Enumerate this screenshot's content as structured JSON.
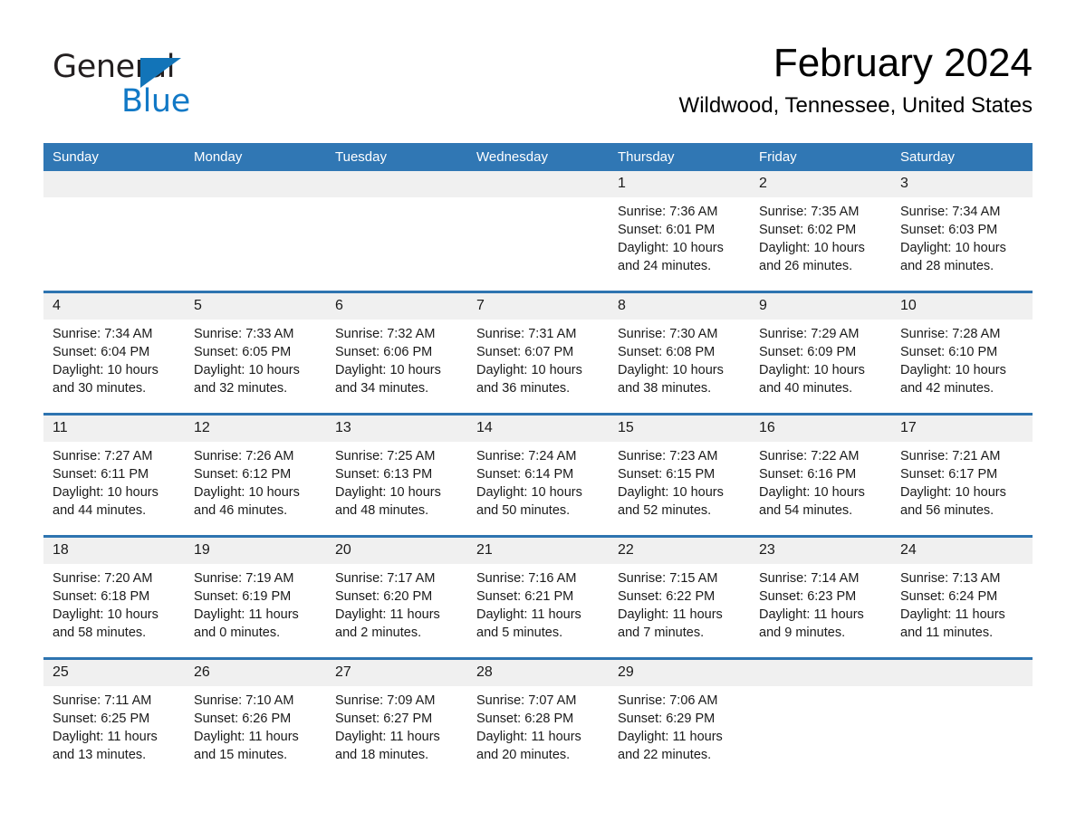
{
  "logo": {
    "word_one": "General",
    "word_two": "Blue",
    "triangle_color": "#1274b8",
    "blue_text_color": "#1279c6",
    "triangle_icon": "right-triangle-icon"
  },
  "header": {
    "month_title": "February 2024",
    "location": "Wildwood, Tennessee, United States"
  },
  "theme": {
    "header_blue": "#3077b4",
    "row_divider_blue": "#2e74b0",
    "daynum_band": "#f0f0f0",
    "page_background": "#ffffff"
  },
  "calendar": {
    "weekday_headers": [
      "Sunday",
      "Monday",
      "Tuesday",
      "Wednesday",
      "Thursday",
      "Friday",
      "Saturday"
    ],
    "weeks": [
      [
        {
          "day": "",
          "sunrise": "",
          "sunset": "",
          "daylight_line1": "",
          "daylight_line2": "",
          "empty": true
        },
        {
          "day": "",
          "sunrise": "",
          "sunset": "",
          "daylight_line1": "",
          "daylight_line2": "",
          "empty": true
        },
        {
          "day": "",
          "sunrise": "",
          "sunset": "",
          "daylight_line1": "",
          "daylight_line2": "",
          "empty": true
        },
        {
          "day": "",
          "sunrise": "",
          "sunset": "",
          "daylight_line1": "",
          "daylight_line2": "",
          "empty": true
        },
        {
          "day": "1",
          "sunrise": "Sunrise: 7:36 AM",
          "sunset": "Sunset: 6:01 PM",
          "daylight_line1": "Daylight: 10 hours",
          "daylight_line2": "and 24 minutes.",
          "empty": false
        },
        {
          "day": "2",
          "sunrise": "Sunrise: 7:35 AM",
          "sunset": "Sunset: 6:02 PM",
          "daylight_line1": "Daylight: 10 hours",
          "daylight_line2": "and 26 minutes.",
          "empty": false
        },
        {
          "day": "3",
          "sunrise": "Sunrise: 7:34 AM",
          "sunset": "Sunset: 6:03 PM",
          "daylight_line1": "Daylight: 10 hours",
          "daylight_line2": "and 28 minutes.",
          "empty": false
        }
      ],
      [
        {
          "day": "4",
          "sunrise": "Sunrise: 7:34 AM",
          "sunset": "Sunset: 6:04 PM",
          "daylight_line1": "Daylight: 10 hours",
          "daylight_line2": "and 30 minutes.",
          "empty": false
        },
        {
          "day": "5",
          "sunrise": "Sunrise: 7:33 AM",
          "sunset": "Sunset: 6:05 PM",
          "daylight_line1": "Daylight: 10 hours",
          "daylight_line2": "and 32 minutes.",
          "empty": false
        },
        {
          "day": "6",
          "sunrise": "Sunrise: 7:32 AM",
          "sunset": "Sunset: 6:06 PM",
          "daylight_line1": "Daylight: 10 hours",
          "daylight_line2": "and 34 minutes.",
          "empty": false
        },
        {
          "day": "7",
          "sunrise": "Sunrise: 7:31 AM",
          "sunset": "Sunset: 6:07 PM",
          "daylight_line1": "Daylight: 10 hours",
          "daylight_line2": "and 36 minutes.",
          "empty": false
        },
        {
          "day": "8",
          "sunrise": "Sunrise: 7:30 AM",
          "sunset": "Sunset: 6:08 PM",
          "daylight_line1": "Daylight: 10 hours",
          "daylight_line2": "and 38 minutes.",
          "empty": false
        },
        {
          "day": "9",
          "sunrise": "Sunrise: 7:29 AM",
          "sunset": "Sunset: 6:09 PM",
          "daylight_line1": "Daylight: 10 hours",
          "daylight_line2": "and 40 minutes.",
          "empty": false
        },
        {
          "day": "10",
          "sunrise": "Sunrise: 7:28 AM",
          "sunset": "Sunset: 6:10 PM",
          "daylight_line1": "Daylight: 10 hours",
          "daylight_line2": "and 42 minutes.",
          "empty": false
        }
      ],
      [
        {
          "day": "11",
          "sunrise": "Sunrise: 7:27 AM",
          "sunset": "Sunset: 6:11 PM",
          "daylight_line1": "Daylight: 10 hours",
          "daylight_line2": "and 44 minutes.",
          "empty": false
        },
        {
          "day": "12",
          "sunrise": "Sunrise: 7:26 AM",
          "sunset": "Sunset: 6:12 PM",
          "daylight_line1": "Daylight: 10 hours",
          "daylight_line2": "and 46 minutes.",
          "empty": false
        },
        {
          "day": "13",
          "sunrise": "Sunrise: 7:25 AM",
          "sunset": "Sunset: 6:13 PM",
          "daylight_line1": "Daylight: 10 hours",
          "daylight_line2": "and 48 minutes.",
          "empty": false
        },
        {
          "day": "14",
          "sunrise": "Sunrise: 7:24 AM",
          "sunset": "Sunset: 6:14 PM",
          "daylight_line1": "Daylight: 10 hours",
          "daylight_line2": "and 50 minutes.",
          "empty": false
        },
        {
          "day": "15",
          "sunrise": "Sunrise: 7:23 AM",
          "sunset": "Sunset: 6:15 PM",
          "daylight_line1": "Daylight: 10 hours",
          "daylight_line2": "and 52 minutes.",
          "empty": false
        },
        {
          "day": "16",
          "sunrise": "Sunrise: 7:22 AM",
          "sunset": "Sunset: 6:16 PM",
          "daylight_line1": "Daylight: 10 hours",
          "daylight_line2": "and 54 minutes.",
          "empty": false
        },
        {
          "day": "17",
          "sunrise": "Sunrise: 7:21 AM",
          "sunset": "Sunset: 6:17 PM",
          "daylight_line1": "Daylight: 10 hours",
          "daylight_line2": "and 56 minutes.",
          "empty": false
        }
      ],
      [
        {
          "day": "18",
          "sunrise": "Sunrise: 7:20 AM",
          "sunset": "Sunset: 6:18 PM",
          "daylight_line1": "Daylight: 10 hours",
          "daylight_line2": "and 58 minutes.",
          "empty": false
        },
        {
          "day": "19",
          "sunrise": "Sunrise: 7:19 AM",
          "sunset": "Sunset: 6:19 PM",
          "daylight_line1": "Daylight: 11 hours",
          "daylight_line2": "and 0 minutes.",
          "empty": false
        },
        {
          "day": "20",
          "sunrise": "Sunrise: 7:17 AM",
          "sunset": "Sunset: 6:20 PM",
          "daylight_line1": "Daylight: 11 hours",
          "daylight_line2": "and 2 minutes.",
          "empty": false
        },
        {
          "day": "21",
          "sunrise": "Sunrise: 7:16 AM",
          "sunset": "Sunset: 6:21 PM",
          "daylight_line1": "Daylight: 11 hours",
          "daylight_line2": "and 5 minutes.",
          "empty": false
        },
        {
          "day": "22",
          "sunrise": "Sunrise: 7:15 AM",
          "sunset": "Sunset: 6:22 PM",
          "daylight_line1": "Daylight: 11 hours",
          "daylight_line2": "and 7 minutes.",
          "empty": false
        },
        {
          "day": "23",
          "sunrise": "Sunrise: 7:14 AM",
          "sunset": "Sunset: 6:23 PM",
          "daylight_line1": "Daylight: 11 hours",
          "daylight_line2": "and 9 minutes.",
          "empty": false
        },
        {
          "day": "24",
          "sunrise": "Sunrise: 7:13 AM",
          "sunset": "Sunset: 6:24 PM",
          "daylight_line1": "Daylight: 11 hours",
          "daylight_line2": "and 11 minutes.",
          "empty": false
        }
      ],
      [
        {
          "day": "25",
          "sunrise": "Sunrise: 7:11 AM",
          "sunset": "Sunset: 6:25 PM",
          "daylight_line1": "Daylight: 11 hours",
          "daylight_line2": "and 13 minutes.",
          "empty": false
        },
        {
          "day": "26",
          "sunrise": "Sunrise: 7:10 AM",
          "sunset": "Sunset: 6:26 PM",
          "daylight_line1": "Daylight: 11 hours",
          "daylight_line2": "and 15 minutes.",
          "empty": false
        },
        {
          "day": "27",
          "sunrise": "Sunrise: 7:09 AM",
          "sunset": "Sunset: 6:27 PM",
          "daylight_line1": "Daylight: 11 hours",
          "daylight_line2": "and 18 minutes.",
          "empty": false
        },
        {
          "day": "28",
          "sunrise": "Sunrise: 7:07 AM",
          "sunset": "Sunset: 6:28 PM",
          "daylight_line1": "Daylight: 11 hours",
          "daylight_line2": "and 20 minutes.",
          "empty": false
        },
        {
          "day": "29",
          "sunrise": "Sunrise: 7:06 AM",
          "sunset": "Sunset: 6:29 PM",
          "daylight_line1": "Daylight: 11 hours",
          "daylight_line2": "and 22 minutes.",
          "empty": false
        },
        {
          "day": "",
          "sunrise": "",
          "sunset": "",
          "daylight_line1": "",
          "daylight_line2": "",
          "empty": true
        },
        {
          "day": "",
          "sunrise": "",
          "sunset": "",
          "daylight_line1": "",
          "daylight_line2": "",
          "empty": true
        }
      ]
    ]
  }
}
